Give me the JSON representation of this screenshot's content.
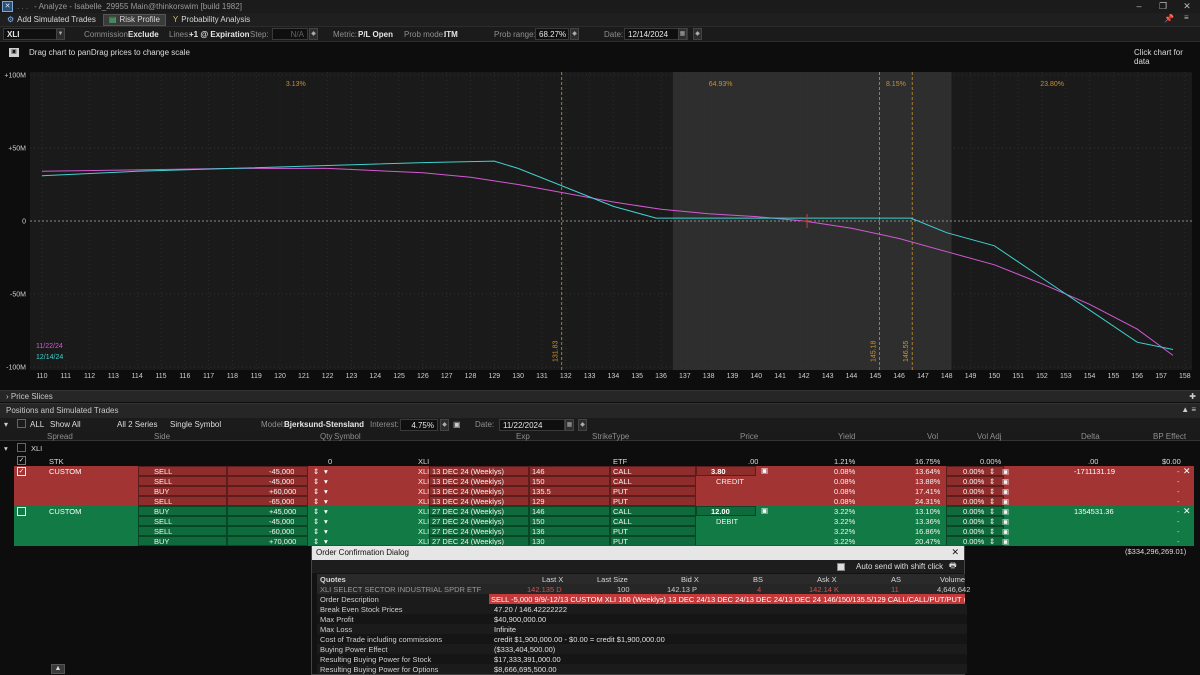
{
  "window": {
    "title": "- Analyze - Isabelle_29955 Main@thinkorswim [build 1982]"
  },
  "toolbar": {
    "add_simulated": "Add Simulated Trades",
    "risk_profile": "Risk Profile",
    "probability": "Probability Analysis"
  },
  "controls": {
    "symbol": "XLI",
    "commission_label": "Commission:",
    "commission": "Exclude",
    "lines_label": "Lines:",
    "lines": "+1 @ Expiration",
    "step_label": "Step:",
    "step": "N/A",
    "metric_label": "Metric:",
    "metric": "P/L Open",
    "probmode_label": "Prob mode:",
    "probmode": "ITM",
    "probrange_label": "Prob range:",
    "probrange": "68.27%",
    "date_label": "Date:",
    "date": "12/14/2024"
  },
  "hints": {
    "left": "Drag chart to panDrag prices to change scale",
    "right": "Click chart for data"
  },
  "chart_data": {
    "type": "line",
    "x_ticks": [
      110,
      111,
      112,
      113,
      114,
      115,
      116,
      117,
      118,
      119,
      120,
      121,
      122,
      123,
      124,
      125,
      126,
      127,
      128,
      129,
      130,
      131,
      132,
      133,
      134,
      135,
      136,
      137,
      138,
      139,
      140,
      141,
      142,
      143,
      144,
      145,
      146,
      147,
      148,
      149,
      150,
      151,
      152,
      153,
      154,
      155,
      156,
      157,
      158
    ],
    "y_ticks": [
      {
        "v": 100,
        "label": "+100M"
      },
      {
        "v": 50,
        "label": "+50M"
      },
      {
        "v": 0,
        "label": "0"
      },
      {
        "v": -50,
        "label": "-50M"
      },
      {
        "v": -100,
        "label": "-100M"
      }
    ],
    "xlim": [
      109.5,
      158.3
    ],
    "ylim": [
      -102,
      102
    ],
    "prob_bands": [
      {
        "x0": 109.5,
        "x1": 131.83,
        "label": "3.13%"
      },
      {
        "x0": 131.83,
        "x1": 145.18,
        "label": "64.93%"
      },
      {
        "x0": 145.18,
        "x1": 146.55,
        "label": "8.15%"
      },
      {
        "x0": 146.55,
        "x1": 158.3,
        "label": "23.80%"
      }
    ],
    "shaded_range": [
      136.5,
      148.2
    ],
    "vlines": [
      {
        "x": 131.83,
        "label": "131.83"
      },
      {
        "x": 145.18,
        "label": "145.18"
      },
      {
        "x": 146.55,
        "label": "146.55"
      }
    ],
    "current_price": 142.135,
    "series": [
      {
        "name": "11/22/24",
        "color": "#d35ad3",
        "x": [
          110,
          114,
          118,
          122,
          126,
          128,
          130,
          132,
          134,
          136,
          138,
          140,
          142,
          144,
          146,
          148,
          150,
          152,
          154,
          156,
          157.5
        ],
        "y": [
          34,
          35,
          36,
          36,
          33,
          30,
          25,
          19,
          13,
          8,
          5,
          3,
          0,
          -5,
          -12,
          -21,
          -30,
          -43,
          -57,
          -74,
          -92
        ]
      },
      {
        "name": "12/14/24",
        "color": "#3fd1cf",
        "x": [
          110,
          114,
          118,
          122,
          126,
          129,
          130,
          132,
          134,
          135.8,
          140,
          142,
          144,
          146.5,
          148,
          150,
          152,
          154,
          156,
          157.5
        ],
        "y": [
          31,
          34,
          36,
          38,
          40,
          41,
          36,
          23,
          10,
          2,
          2,
          2,
          2,
          2,
          -8,
          -17,
          -39,
          -61,
          -83,
          -88
        ]
      }
    ]
  },
  "sections": {
    "price_slices": "Price Slices",
    "positions": "Positions and Simulated Trades"
  },
  "positions_controls": {
    "all": "ALL",
    "show": "Show All",
    "series": "All 2 Series",
    "single": "Single Symbol",
    "model_label": "Model:",
    "model": "Bjerksund-Stensland",
    "interest_label": "Interest:",
    "interest": "4.75%",
    "date_label": "Date:",
    "date": "11/22/2024"
  },
  "columns": [
    "Spread",
    "Side",
    "Qty",
    "Symbol",
    "Exp",
    "Strike",
    "Type",
    "Price",
    "Yield",
    "Vol",
    "Vol Adj",
    "Delta",
    "BP Effect"
  ],
  "group": "XLI",
  "stk_row": {
    "spread": "STK",
    "qty": "0",
    "symbol": "XLI",
    "type": "ETF",
    "price": ".00",
    "yield": "1.21%",
    "vol": "16.75%",
    "voladj": "0.00%",
    "delta": ".00",
    "bp": "$0.00"
  },
  "trade1": {
    "spread": "CUSTOM",
    "price": "3.80",
    "note": "CREDIT",
    "delta": "-1711131.19",
    "legs": [
      {
        "side": "SELL",
        "qty": "-45,000",
        "symbol": "XLI",
        "exp": "13 DEC 24 (Weeklys)",
        "strike": "146",
        "type": "CALL",
        "yield": "0.08%",
        "vol": "13.64%",
        "voladj": "0.00%"
      },
      {
        "side": "SELL",
        "qty": "-45,000",
        "symbol": "XLI",
        "exp": "13 DEC 24 (Weeklys)",
        "strike": "150",
        "type": "CALL",
        "yield": "0.08%",
        "vol": "13.88%",
        "voladj": "0.00%"
      },
      {
        "side": "BUY",
        "qty": "+60,000",
        "symbol": "XLI",
        "exp": "13 DEC 24 (Weeklys)",
        "strike": "135.5",
        "type": "PUT",
        "yield": "0.08%",
        "vol": "17.41%",
        "voladj": "0.00%"
      },
      {
        "side": "SELL",
        "qty": "-65,000",
        "symbol": "XLI",
        "exp": "13 DEC 24 (Weeklys)",
        "strike": "129",
        "type": "PUT",
        "yield": "0.08%",
        "vol": "24.31%",
        "voladj": "0.00%"
      }
    ]
  },
  "trade2": {
    "spread": "CUSTOM",
    "price": "12.00",
    "note": "DEBIT",
    "delta": "1354531.36",
    "legs": [
      {
        "side": "BUY",
        "qty": "+45,000",
        "symbol": "XLI",
        "exp": "27 DEC 24 (Weeklys)",
        "strike": "146",
        "type": "CALL",
        "yield": "3.22%",
        "vol": "13.10%",
        "voladj": "0.00%"
      },
      {
        "side": "SELL",
        "qty": "-45,000",
        "symbol": "XLI",
        "exp": "27 DEC 24 (Weeklys)",
        "strike": "150",
        "type": "CALL",
        "yield": "3.22%",
        "vol": "13.36%",
        "voladj": "0.00%"
      },
      {
        "side": "SELL",
        "qty": "-60,000",
        "symbol": "XLI",
        "exp": "27 DEC 24 (Weeklys)",
        "strike": "136",
        "type": "PUT",
        "yield": "3.22%",
        "vol": "16.86%",
        "voladj": "0.00%"
      },
      {
        "side": "BUY",
        "qty": "+70,000",
        "symbol": "XLI",
        "exp": "27 DEC 24 (Weeklys)",
        "strike": "130",
        "type": "PUT",
        "yield": "3.22%",
        "vol": "20.47%",
        "voladj": "0.00%"
      }
    ]
  },
  "total_bp": "($334,296,269.01)",
  "dialog": {
    "title": "Order Confirmation Dialog",
    "auto_send": "Auto send with shift click",
    "quote_headers": [
      "Quotes",
      "Last X",
      "Last Size",
      "Bid X",
      "BS",
      "Ask X",
      "AS",
      "Volume"
    ],
    "quote": {
      "name": "XLI  SELECT SECTOR INDUSTRIAL SPDR ETF",
      "last": "142.135 D",
      "lastsize": "100",
      "bid": "142.13 P",
      "bs": "4",
      "ask": "142.14 K",
      "as": "11",
      "volume": "4,646,642"
    },
    "order_description_label": "Order Description",
    "order_description": "SELL -5,000 9/9/-12/13 CUSTOM XLI 100 (Weeklys) 13 DEC 24/13 DEC 24/13 DEC 24/13 DEC 24 146/150/135.5/129 CALL/CALL/PUT/PUT @3.80 LMT [T...",
    "rows": [
      {
        "k": "Break Even Stock Prices",
        "v": "47.20 / 146.42222222"
      },
      {
        "k": "Max Profit",
        "v": "$40,900,000.00"
      },
      {
        "k": "Max Loss",
        "v": "Infinite"
      },
      {
        "k": "Cost of Trade including commissions",
        "v": "credit $1,900,000.00 - $0.00 = credit $1,900,000.00"
      },
      {
        "k": "Buying Power Effect",
        "v": "($333,404,500.00)"
      },
      {
        "k": "Resulting Buying Power for Stock",
        "v": "$17,333,391,000.00"
      },
      {
        "k": "Resulting Buying Power for Options",
        "v": "$8,666,695,500.00"
      }
    ]
  }
}
